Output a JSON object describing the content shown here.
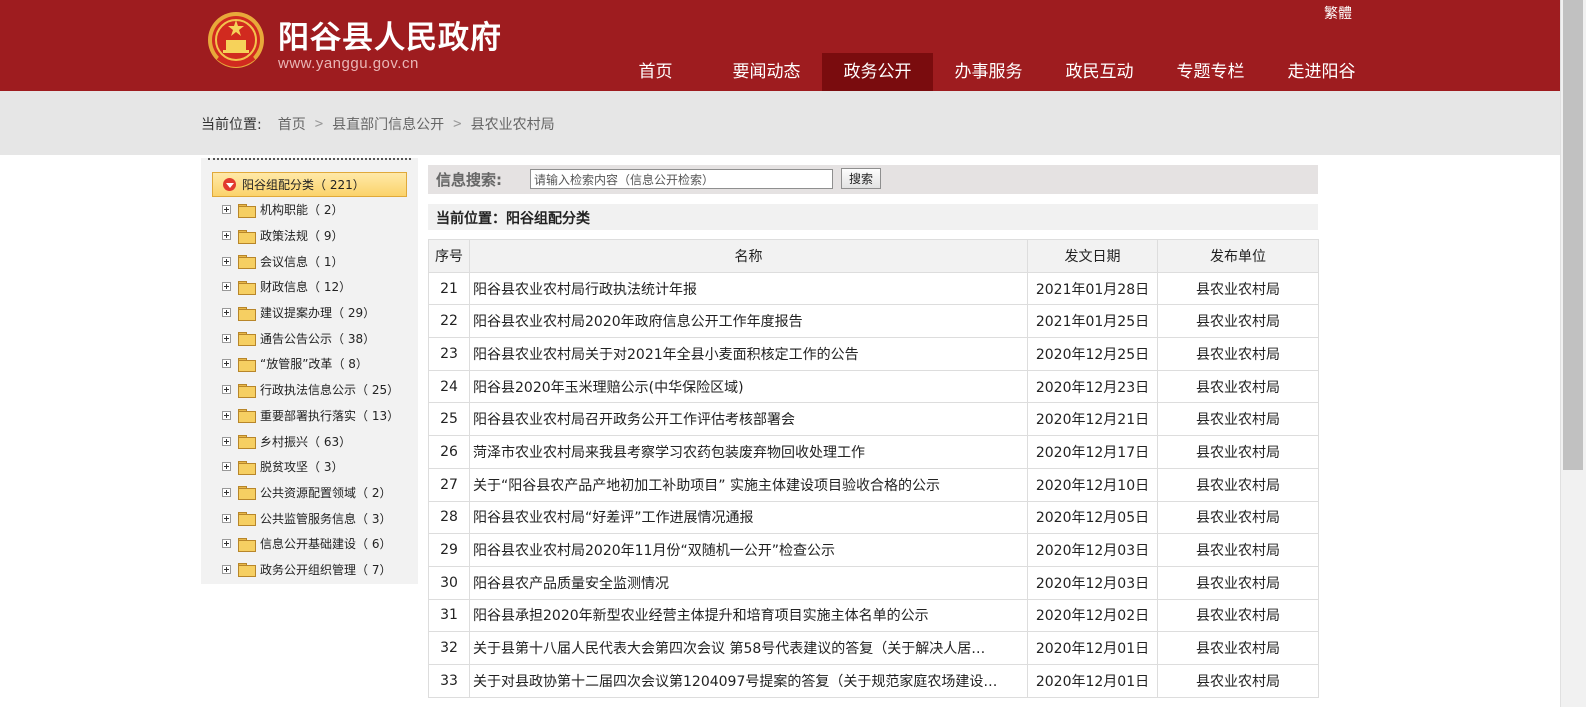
{
  "header": {
    "site_title": "阳谷县人民政府",
    "site_url": "www.yanggu.gov.cn",
    "lang_link": "繁體",
    "colors": {
      "brand": "#9e1c1f",
      "active_nav": "#7a0c0e"
    }
  },
  "nav": [
    {
      "label": "首页",
      "active": false
    },
    {
      "label": "要闻动态",
      "active": false
    },
    {
      "label": "政务公开",
      "active": true
    },
    {
      "label": "办事服务",
      "active": false
    },
    {
      "label": "政民互动",
      "active": false
    },
    {
      "label": "专题专栏",
      "active": false
    },
    {
      "label": "走进阳谷",
      "active": false
    }
  ],
  "breadcrumb": {
    "label": "当前位置:",
    "items": [
      "首页",
      "县直部门信息公开",
      "县农业农村局"
    ]
  },
  "sidebar": {
    "root": {
      "name": "阳谷组配分类",
      "count": "（ 221）"
    },
    "items": [
      {
        "name": "机构职能",
        "count": "（ 2）"
      },
      {
        "name": "政策法规",
        "count": "（ 9）"
      },
      {
        "name": "会议信息",
        "count": "（ 1）"
      },
      {
        "name": "财政信息",
        "count": "（ 12）"
      },
      {
        "name": "建议提案办理",
        "count": "（ 29）"
      },
      {
        "name": "通告公告公示",
        "count": "（ 38）"
      },
      {
        "name": "“放管服”改革",
        "count": "（ 8）"
      },
      {
        "name": "行政执法信息公示",
        "count": "（ 25）"
      },
      {
        "name": "重要部署执行落实",
        "count": "（ 13）"
      },
      {
        "name": "乡村振兴",
        "count": "（ 63）"
      },
      {
        "name": "脱贫攻坚",
        "count": "（ 3）"
      },
      {
        "name": "公共资源配置领域",
        "count": "（ 2）"
      },
      {
        "name": "公共监管服务信息",
        "count": "（ 3）"
      },
      {
        "name": "信息公开基础建设",
        "count": "（ 6）"
      },
      {
        "name": "政务公开组织管理",
        "count": "（ 7）"
      }
    ]
  },
  "search": {
    "label": "信息搜索:",
    "value": "请输入检索内容（信息公开检索）",
    "button": "搜索"
  },
  "current": {
    "title": "当前位置：阳谷组配分类"
  },
  "table": {
    "headers": [
      "序号",
      "名称",
      "发文日期",
      "发布单位"
    ],
    "rows": [
      {
        "no": "21",
        "title": "阳谷县农业农村局行政执法统计年报",
        "date": "2021年01月28日",
        "unit": "县农业农村局"
      },
      {
        "no": "22",
        "title": "阳谷县农业农村局2020年政府信息公开工作年度报告",
        "date": "2021年01月25日",
        "unit": "县农业农村局"
      },
      {
        "no": "23",
        "title": "阳谷县农业农村局关于对2021年全县小麦面积核定工作的公告",
        "date": "2020年12月25日",
        "unit": "县农业农村局"
      },
      {
        "no": "24",
        "title": "阳谷县2020年玉米理赔公示(中华保险区域)",
        "date": "2020年12月23日",
        "unit": "县农业农村局"
      },
      {
        "no": "25",
        "title": "阳谷县农业农村局召开政务公开工作评估考核部署会",
        "date": "2020年12月21日",
        "unit": "县农业农村局"
      },
      {
        "no": "26",
        "title": "菏泽市农业农村局来我县考察学习农药包装废弃物回收处理工作",
        "date": "2020年12月17日",
        "unit": "县农业农村局"
      },
      {
        "no": "27",
        "title": "关于“阳谷县农产品产地初加工补助项目” 实施主体建设项目验收合格的公示",
        "date": "2020年12月10日",
        "unit": "县农业农村局"
      },
      {
        "no": "28",
        "title": "阳谷县农业农村局“好差评”工作进展情况通报",
        "date": "2020年12月05日",
        "unit": "县农业农村局"
      },
      {
        "no": "29",
        "title": "阳谷县农业农村局2020年11月份“双随机一公开”检查公示",
        "date": "2020年12月03日",
        "unit": "县农业农村局"
      },
      {
        "no": "30",
        "title": "阳谷县农产品质量安全监测情况",
        "date": "2020年12月03日",
        "unit": "县农业农村局"
      },
      {
        "no": "31",
        "title": "阳谷县承担2020年新型农业经营主体提升和培育项目实施主体名单的公示",
        "date": "2020年12月02日",
        "unit": "县农业农村局"
      },
      {
        "no": "32",
        "title": "关于县第十八届人民代表大会第四次会议 第58号代表建议的答复（关于解决人居…",
        "date": "2020年12月01日",
        "unit": "县农业农村局"
      },
      {
        "no": "33",
        "title": "关于对县政协第十二届四次会议第1204097号提案的答复（关于规范家庭农场建设…",
        "date": "2020年12月01日",
        "unit": "县农业农村局"
      }
    ]
  }
}
